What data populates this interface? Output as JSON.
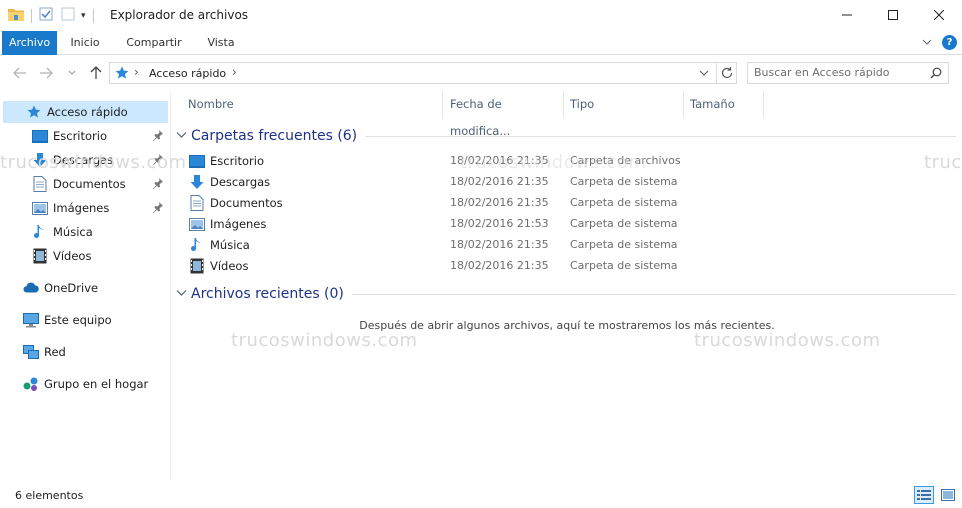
{
  "window": {
    "title": "Explorador de archivos",
    "controls": {
      "minimize": "—",
      "maximize": "☐",
      "close": "✕"
    }
  },
  "ribbon": {
    "tabs": [
      {
        "label": "Archivo"
      },
      {
        "label": "Inicio"
      },
      {
        "label": "Compartir"
      },
      {
        "label": "Vista"
      }
    ],
    "help": "?"
  },
  "address": {
    "crumb": "Acceso rápido",
    "separator": "›"
  },
  "search": {
    "placeholder": "Buscar en Acceso rápido"
  },
  "nav": {
    "quick_access": "Acceso rápido",
    "items": [
      {
        "label": "Escritorio",
        "icon": "desktop-icon",
        "pinned": true
      },
      {
        "label": "Descargas",
        "icon": "downloads-icon",
        "pinned": true
      },
      {
        "label": "Documentos",
        "icon": "documents-icon",
        "pinned": true
      },
      {
        "label": "Imágenes",
        "icon": "pictures-icon",
        "pinned": true
      },
      {
        "label": "Música",
        "icon": "music-icon",
        "pinned": false
      },
      {
        "label": "Vídeos",
        "icon": "videos-icon",
        "pinned": false
      }
    ],
    "onedrive": "OneDrive",
    "this_pc": "Este equipo",
    "network": "Red",
    "homegroup": "Grupo en el hogar"
  },
  "columns": {
    "name": "Nombre",
    "date": "Fecha de modifica...",
    "type": "Tipo",
    "size": "Tamaño"
  },
  "groups": {
    "frequent": "Carpetas frecuentes (6)",
    "recent": "Archivos recientes (0)"
  },
  "frequent_folders": [
    {
      "name": "Escritorio",
      "date": "18/02/2016 21:35",
      "type": "Carpeta de archivos"
    },
    {
      "name": "Descargas",
      "date": "18/02/2016 21:35",
      "type": "Carpeta de sistema"
    },
    {
      "name": "Documentos",
      "date": "18/02/2016 21:35",
      "type": "Carpeta de sistema"
    },
    {
      "name": "Imágenes",
      "date": "18/02/2016 21:53",
      "type": "Carpeta de sistema"
    },
    {
      "name": "Música",
      "date": "18/02/2016 21:35",
      "type": "Carpeta de sistema"
    },
    {
      "name": "Vídeos",
      "date": "18/02/2016 21:35",
      "type": "Carpeta de sistema"
    }
  ],
  "empty_recent": "Después de abrir algunos archivos, aquí te mostraremos los más recientes.",
  "status": {
    "items": "6 elementos"
  },
  "watermark": "trucoswindows.com",
  "colors": {
    "accent": "#1979ca",
    "selected": "#cce8ff",
    "group_title": "#1e3287"
  }
}
